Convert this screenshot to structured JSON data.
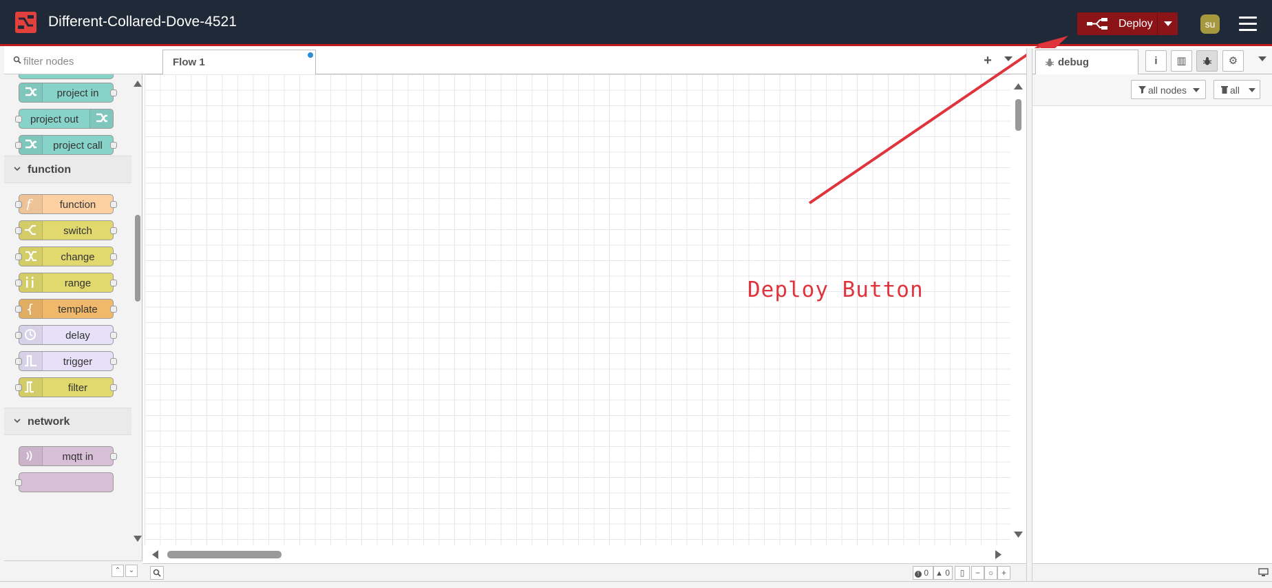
{
  "header": {
    "title": "Different-Collared-Dove-4521",
    "deploy_label": "Deploy",
    "user_initials": "su"
  },
  "palette": {
    "filter_placeholder": "filter nodes",
    "categories": {
      "function": "function",
      "network": "network"
    },
    "nodes": {
      "project_in": "project in",
      "project_out": "project out",
      "project_call": "project call",
      "function": "function",
      "switch": "switch",
      "change": "change",
      "range": "range",
      "template": "template",
      "delay": "delay",
      "trigger": "trigger",
      "filter": "filter",
      "mqtt_in": "mqtt in"
    },
    "colors": {
      "project": "#87d3c9",
      "function": "#fdd0a2",
      "switch": "#e2d96e",
      "template": "#f0b86a",
      "delay": "#e6e0f8",
      "mqtt": "#d8bfd8"
    }
  },
  "workspace": {
    "tab_label": "Flow 1",
    "annotation": "Deploy Button",
    "status_errors": "0",
    "status_warnings": "0"
  },
  "sidebar": {
    "tab_label": "debug",
    "filter_nodes_label": "all nodes",
    "clear_label": "all"
  },
  "colors": {
    "header_bg": "#1f2937",
    "deploy_bg": "#8b1419",
    "accent_red": "#c01a1a",
    "annotation_red": "#e0343c"
  }
}
